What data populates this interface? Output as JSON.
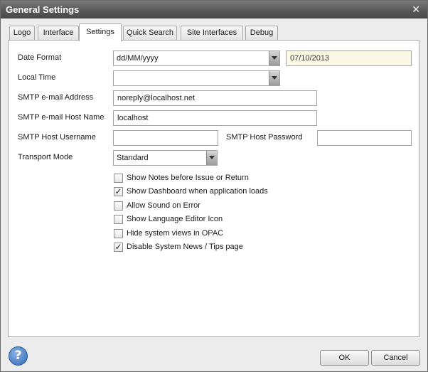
{
  "window": {
    "title": "General Settings"
  },
  "tabs": [
    {
      "label": "Logo",
      "active": false
    },
    {
      "label": "Interface",
      "active": false
    },
    {
      "label": "Settings",
      "active": true
    },
    {
      "label": "Quick Search",
      "active": false
    },
    {
      "label": "Site Interfaces",
      "active": false
    },
    {
      "label": "Debug",
      "active": false
    }
  ],
  "form": {
    "date_format": {
      "label": "Date Format",
      "value": "dd/MM/yyyy",
      "preview": "07/10/2013"
    },
    "local_time": {
      "label": "Local Time",
      "value": ""
    },
    "smtp_address": {
      "label": "SMTP e-mail Address",
      "value": "noreply@localhost.net"
    },
    "smtp_host": {
      "label": "SMTP e-mail Host Name",
      "value": "localhost"
    },
    "smtp_username": {
      "label": "SMTP Host Username",
      "value": ""
    },
    "smtp_password": {
      "label": "SMTP Host Password",
      "value": ""
    },
    "transport_mode": {
      "label": "Transport Mode",
      "value": "Standard"
    }
  },
  "options": [
    {
      "label": "Show Notes before Issue or Return",
      "checked": false
    },
    {
      "label": "Show Dashboard when application loads",
      "checked": true
    },
    {
      "label": "Allow Sound on Error",
      "checked": false
    },
    {
      "label": "Show Language Editor Icon",
      "checked": false
    },
    {
      "label": "Hide system views in OPAC",
      "checked": false
    },
    {
      "label": "Disable System News / Tips page",
      "checked": true
    }
  ],
  "footer": {
    "help_icon": "?",
    "ok_label": "OK",
    "cancel_label": "Cancel"
  },
  "icons": {
    "close": "close-icon",
    "help": "help-icon",
    "check": "check-icon",
    "dropdown": "chevron-down-icon"
  }
}
